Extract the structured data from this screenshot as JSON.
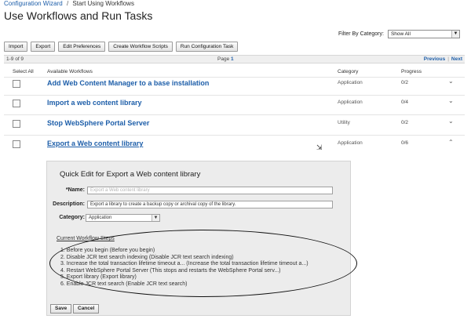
{
  "breadcrumb": {
    "root": "Configuration Wizard",
    "separator": "/",
    "current": "Start Using Workflows"
  },
  "page_title": "Use Workflows and Run Tasks",
  "toolbar": {
    "buttons": [
      "Import",
      "Export",
      "Edit Preferences",
      "Create Workflow Scripts",
      "Run Configuration Task"
    ]
  },
  "filter": {
    "label": "Filter By Category:",
    "value": "Show All",
    "arrow": "▼"
  },
  "pager": {
    "count": "1-9 of 9",
    "page_label": "Page",
    "page_number": "1",
    "previous": "Previous",
    "separator": "|",
    "next": "Next"
  },
  "table": {
    "select_all": "Select All",
    "headers": {
      "workflows": "Available Workflows",
      "category": "Category",
      "progress": "Progress"
    },
    "rows": [
      {
        "title": "Add Web Content Manager to a base installation",
        "category": "Application",
        "progress": "0/2",
        "chevron": "⌄"
      },
      {
        "title": "Import a web content library",
        "category": "Application",
        "progress": "0/4",
        "chevron": "⌄"
      },
      {
        "title": "Stop WebSphere Portal Server",
        "category": "Utility",
        "progress": "0/2",
        "chevron": "⌄"
      },
      {
        "title": "Export a Web content library",
        "category": "Application",
        "progress": "0/6",
        "chevron": "⌃"
      }
    ]
  },
  "quick_edit": {
    "title": "Quick Edit for Export a Web content library",
    "name_label": "*Name:",
    "name_placeholder": "Export a Web content library",
    "description_label": "Description:",
    "description_value": "Export a library to create a backup copy or archival copy of the library.",
    "category_label": "Category:",
    "category_value": "Application",
    "category_arrow": "▼",
    "steps_title": "Current Workflow Steps",
    "steps": [
      "1.  Before you begin (Before you begin)",
      "2.  Disable JCR text search indexing (Disable JCR text search indexing)",
      "3.  Increase the total transaction lifetime timeout a... (Increase the total transaction lifetime timeout a...)",
      "4.  Restart WebSphere Portal Server (This stops and restarts the WebSphere Portal serv...)",
      "5.  Export library (Export library)",
      "6.  Enable JCR text search (Enable JCR text search)"
    ],
    "save_label": "Save",
    "cancel_label": "Cancel"
  },
  "icons": {
    "cursor": "move-cursor-icon",
    "chevron": "chevron-icon"
  }
}
